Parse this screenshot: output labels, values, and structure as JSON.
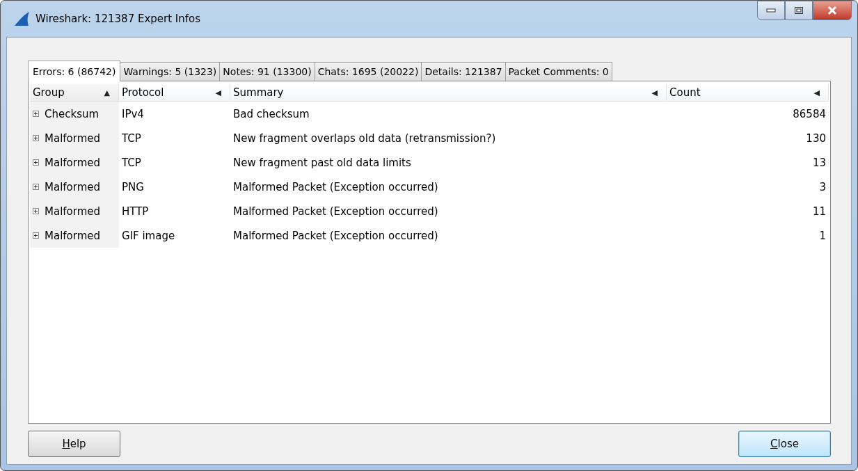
{
  "window": {
    "title": "Wireshark: 121387 Expert Infos"
  },
  "tabs": [
    {
      "label": "Errors: 6 (86742)",
      "selected": true
    },
    {
      "label": "Warnings: 5 (1323)",
      "selected": false
    },
    {
      "label": "Notes: 91 (13300)",
      "selected": false
    },
    {
      "label": "Chats: 1695 (20022)",
      "selected": false
    },
    {
      "label": "Details: 121387",
      "selected": false
    },
    {
      "label": "Packet Comments: 0",
      "selected": false
    }
  ],
  "table": {
    "columns": [
      {
        "label": "Group",
        "indicator": "▲",
        "sorted": true
      },
      {
        "label": "Protocol",
        "indicator": "◀",
        "sorted": false
      },
      {
        "label": "Summary",
        "indicator": "◀",
        "sorted": false
      },
      {
        "label": "Count",
        "indicator": "◀",
        "sorted": false
      }
    ],
    "rows": [
      {
        "expanded": false,
        "group": "Checksum",
        "protocol": "IPv4",
        "summary": "Bad checksum",
        "count": "86584"
      },
      {
        "expanded": false,
        "group": "Malformed",
        "protocol": "TCP",
        "summary": "New fragment overlaps old data (retransmission?)",
        "count": "130"
      },
      {
        "expanded": false,
        "group": "Malformed",
        "protocol": "TCP",
        "summary": "New fragment past old data limits",
        "count": "13"
      },
      {
        "expanded": false,
        "group": "Malformed",
        "protocol": "PNG",
        "summary": "Malformed Packet (Exception occurred)",
        "count": "3"
      },
      {
        "expanded": false,
        "group": "Malformed",
        "protocol": "HTTP",
        "summary": "Malformed Packet (Exception occurred)",
        "count": "11"
      },
      {
        "expanded": false,
        "group": "Malformed",
        "protocol": "GIF image",
        "summary": "Malformed Packet (Exception occurred)",
        "count": "1"
      }
    ]
  },
  "buttons": [
    {
      "label": "Help",
      "default": false
    },
    {
      "label": "Close",
      "default": true
    }
  ]
}
